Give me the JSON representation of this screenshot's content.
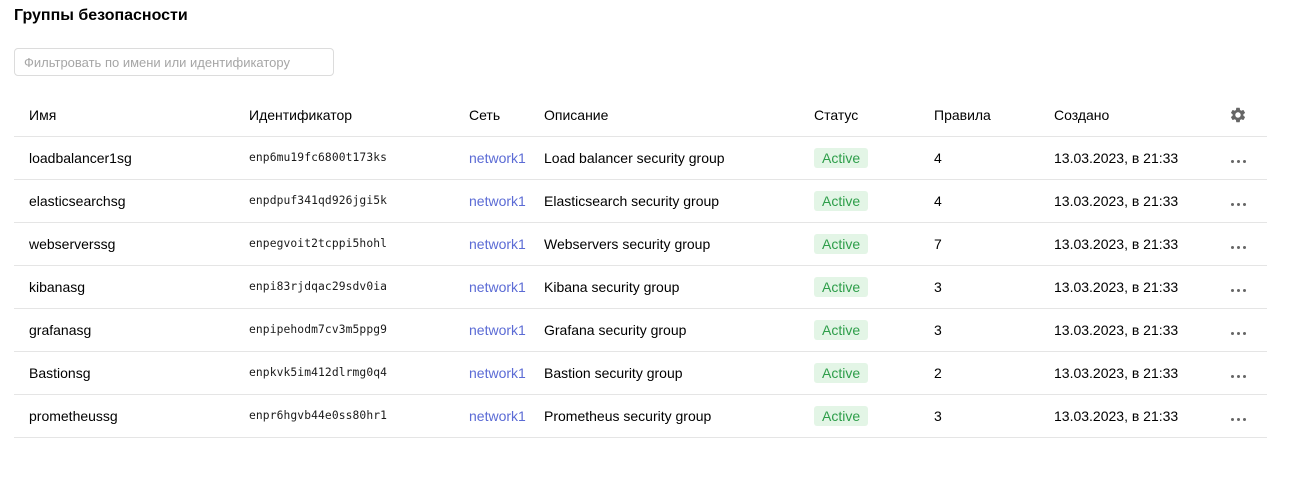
{
  "page": {
    "title": "Группы безопасности"
  },
  "filter": {
    "placeholder": "Фильтровать по имени или идентификатору",
    "value": ""
  },
  "table": {
    "columns": {
      "name": "Имя",
      "id": "Идентификатор",
      "network": "Сеть",
      "description": "Описание",
      "status": "Статус",
      "rules": "Правила",
      "created": "Создано"
    },
    "settings_icon": "gear-icon",
    "row_action_icon": "more-horizontal-icon",
    "rows": [
      {
        "name": "loadbalancer1sg",
        "id": "enp6mu19fc6800t173ks",
        "network": "network1",
        "description": "Load balancer security group",
        "status": "Active",
        "rules": "4",
        "created": "13.03.2023, в 21:33"
      },
      {
        "name": "elasticsearchsg",
        "id": "enpdpuf341qd926jgi5k",
        "network": "network1",
        "description": "Elasticsearch security group",
        "status": "Active",
        "rules": "4",
        "created": "13.03.2023, в 21:33"
      },
      {
        "name": "webserverssg",
        "id": "enpegvoit2tcppi5hohl",
        "network": "network1",
        "description": "Webservers security group",
        "status": "Active",
        "rules": "7",
        "created": "13.03.2023, в 21:33"
      },
      {
        "name": "kibanasg",
        "id": "enpi83rjdqac29sdv0ia",
        "network": "network1",
        "description": "Kibana security group",
        "status": "Active",
        "rules": "3",
        "created": "13.03.2023, в 21:33"
      },
      {
        "name": "grafanasg",
        "id": "enpipehodm7cv3m5ppg9",
        "network": "network1",
        "description": "Grafana security group",
        "status": "Active",
        "rules": "3",
        "created": "13.03.2023, в 21:33"
      },
      {
        "name": "Bastionsg",
        "id": "enpkvk5im412dlrmg0q4",
        "network": "network1",
        "description": "Bastion security group",
        "status": "Active",
        "rules": "2",
        "created": "13.03.2023, в 21:33"
      },
      {
        "name": "prometheussg",
        "id": "enpr6hgvb44e0ss80hr1",
        "network": "network1",
        "description": "Prometheus security group",
        "status": "Active",
        "rules": "3",
        "created": "13.03.2023, в 21:33"
      }
    ]
  },
  "colors": {
    "link": "#5b6bd5",
    "status_active_text": "#2e9e4a",
    "status_active_bg": "#e3f5e6",
    "divider": "#e5e5e5",
    "icon": "#666666"
  }
}
